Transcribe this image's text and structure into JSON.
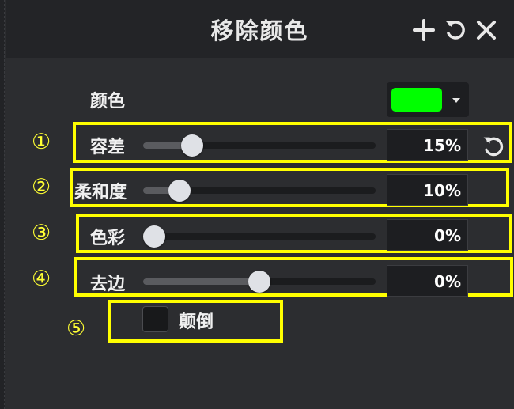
{
  "panel": {
    "title": "移除颜色",
    "icons": {
      "add": "plus-icon",
      "reset": "rotate-ccw-icon",
      "close": "close-icon"
    }
  },
  "color": {
    "label": "颜色",
    "swatch": "#00ff00"
  },
  "sliders": [
    {
      "number": "①",
      "label": "容差",
      "value_text": "15%",
      "value_fraction": 0.18
    },
    {
      "number": "②",
      "label": "柔和度",
      "value_text": "10%",
      "value_fraction": 0.12
    },
    {
      "number": "③",
      "label": "色彩",
      "value_text": "0%",
      "value_fraction": 0.0
    },
    {
      "number": "④",
      "label": "去边",
      "value_text": "0%",
      "value_fraction": 0.5
    }
  ],
  "invert": {
    "number": "⑤",
    "label": "颠倒",
    "checked": false
  },
  "colors": {
    "highlight": "#ffff00",
    "panel_bg": "#2c2d30",
    "header_bg": "#232427"
  }
}
